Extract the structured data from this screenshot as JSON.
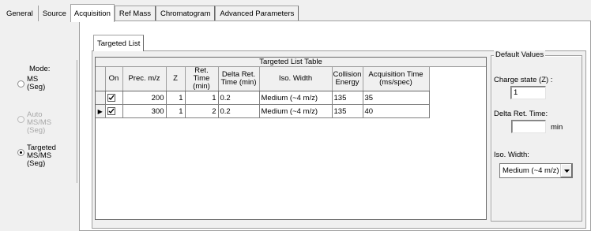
{
  "top_tabs": [
    {
      "label": "General",
      "active": false
    },
    {
      "label": "Source",
      "active": false
    },
    {
      "label": "Acquisition",
      "active": true
    },
    {
      "label": "Ref Mass",
      "active": false
    },
    {
      "label": "Chromatogram",
      "active": false
    },
    {
      "label": "Advanced Parameters",
      "active": false
    }
  ],
  "inner_tab": {
    "label": "Targeted List"
  },
  "mode": {
    "label": "Mode:",
    "options": [
      {
        "lines": [
          "MS",
          "(Seg)"
        ],
        "selected": false,
        "enabled": true
      },
      {
        "lines": [
          "Auto",
          "MS/MS",
          "(Seg)"
        ],
        "selected": false,
        "enabled": false
      },
      {
        "lines": [
          "Targeted",
          "MS/MS",
          "(Seg)"
        ],
        "selected": true,
        "enabled": true
      }
    ]
  },
  "table": {
    "title": "Targeted List Table",
    "columns": [
      "On",
      "Prec. m/z",
      "Z",
      "Ret. Time (min)",
      "Delta Ret. Time (min)",
      "Iso. Width",
      "Collision Energy",
      "Acquisition Time (ms/spec)"
    ],
    "rows": [
      {
        "current": false,
        "on": true,
        "prec_mz": "200",
        "z": "1",
        "ret_time": "1",
        "delta_ret": "0.2",
        "iso_width": "Medium (~4 m/z)",
        "collision_energy": "135",
        "acq_time": "35"
      },
      {
        "current": true,
        "on": true,
        "prec_mz": "300",
        "z": "1",
        "ret_time": "2",
        "delta_ret": "0.2",
        "iso_width": "Medium (~4 m/z)",
        "collision_energy": "135",
        "acq_time": "40"
      }
    ]
  },
  "defaults": {
    "legend": "Default Values",
    "charge_label": "Charge state (Z) :",
    "charge_value": "1",
    "delta_label": "Delta Ret. Time:",
    "delta_value": "",
    "delta_unit": "min",
    "iso_label": "Iso. Width:",
    "iso_value": "Medium (~4 m/z)"
  },
  "icons": {
    "row_indicator": "arrow-right-icon",
    "checkbox": "checkmark-icon",
    "combo": "chevron-down-icon"
  }
}
